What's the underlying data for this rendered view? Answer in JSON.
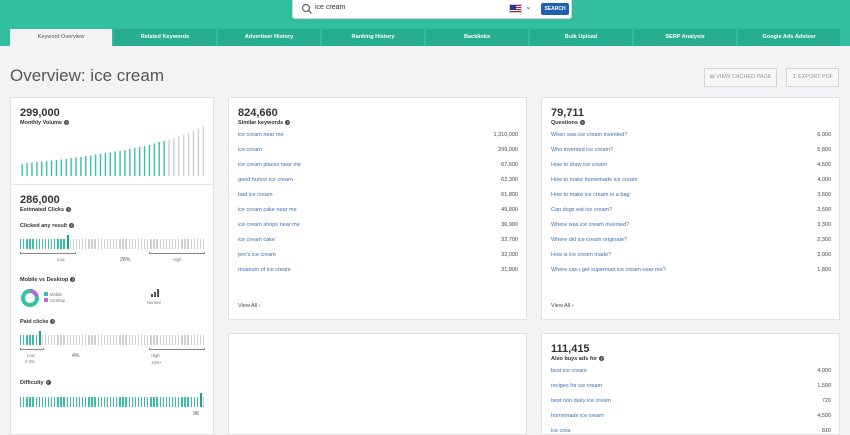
{
  "search": {
    "query": "ice cream",
    "button": "SEARCH",
    "country": "US"
  },
  "tabs": [
    "Keyword Overview",
    "Related Keywords",
    "Advertiser History",
    "Ranking History",
    "Backlinks",
    "Bulk Upload",
    "SERP Analysis",
    "Google Ads Advisor"
  ],
  "page_title": "Overview: ice cream",
  "actions": {
    "cached": "VIEW CACHED PAGE",
    "export": "EXPORT PDF"
  },
  "colors": {
    "accent": "#31bfa0",
    "bar_active": "#39c2a2",
    "bar_inactive": "#cfcfcf",
    "link": "#3a6fb0"
  },
  "volume": {
    "value": "299,000",
    "label": "Monthly Volume",
    "bars": [
      0.24,
      0.26,
      0.27,
      0.28,
      0.29,
      0.3,
      0.31,
      0.32,
      0.33,
      0.34,
      0.36,
      0.37,
      0.38,
      0.4,
      0.41,
      0.43,
      0.44,
      0.46,
      0.47,
      0.49,
      0.5,
      0.52,
      0.54,
      0.56,
      0.58,
      0.6,
      0.62,
      0.65,
      0.68,
      0.7,
      0.73,
      0.76,
      0.79,
      0.82,
      0.86,
      0.9,
      0.95,
      1.0
    ],
    "active_count": 30
  },
  "clicks": {
    "value": "286,000",
    "label": "Estimated Clicks"
  },
  "clicked_any": {
    "label": "Clicked any result",
    "pct": "26%",
    "low": "Low",
    "high": "High",
    "level": 0.26
  },
  "mobile": {
    "label": "Mobile vs Desktop",
    "legend": [
      "Mobile",
      "Desktop"
    ],
    "desktop_share": 0.2,
    "normal": "Normal"
  },
  "paid": {
    "label": "Paid clicks",
    "pct": "4%",
    "low": "Low",
    "low_sub": "0-3%",
    "high": "High",
    "high_sub": "13%+",
    "level": 0.12
  },
  "difficulty": {
    "label": "Difficulty",
    "value": "98",
    "level": 0.98
  },
  "similar": {
    "value": "824,660",
    "label": "Similar keywords",
    "view_all": "View All",
    "rows": [
      [
        "ice cream near me",
        "1,310,000"
      ],
      [
        "ice cream",
        "299,000"
      ],
      [
        "ice cream places near me",
        "67,600"
      ],
      [
        "good humor ice cream",
        "62,300"
      ],
      [
        "bad ice cream",
        "61,800"
      ],
      [
        "ice cream cake near me",
        "49,800"
      ],
      [
        "ice cream shops near me",
        "36,900"
      ],
      [
        "ice cream cake",
        "32,700"
      ],
      [
        "jeni's ice cream",
        "32,000"
      ],
      [
        "museum of ice cream",
        "31,800"
      ]
    ]
  },
  "questions": {
    "value": "79,711",
    "label": "Questions",
    "view_all": "View All",
    "rows": [
      [
        "When was ice cream invented?",
        "6,000"
      ],
      [
        "Who invented ice cream?",
        "5,800"
      ],
      [
        "How to draw ice cream",
        "4,500"
      ],
      [
        "How to make homemade ice cream",
        "4,000"
      ],
      [
        "How to make ice cream in a bag",
        "3,600"
      ],
      [
        "Can dogs eat ice cream?",
        "3,500"
      ],
      [
        "Where was ice cream invented?",
        "3,300"
      ],
      [
        "Where did ice cream originate?",
        "2,300"
      ],
      [
        "How is ice cream made?",
        "2,000"
      ],
      [
        "Where can i get superman ice cream near me?",
        "1,800"
      ]
    ]
  },
  "also_buys": {
    "value": "111,415",
    "label": "Also buys ads for",
    "rows": [
      [
        "best ice cream",
        "4,000"
      ],
      [
        "recipes for ice cream",
        "1,500"
      ],
      [
        "best non dairy ice cream",
        "720"
      ],
      [
        "homemade ice cream",
        "4,500"
      ],
      [
        "ice crea",
        "810"
      ]
    ]
  }
}
